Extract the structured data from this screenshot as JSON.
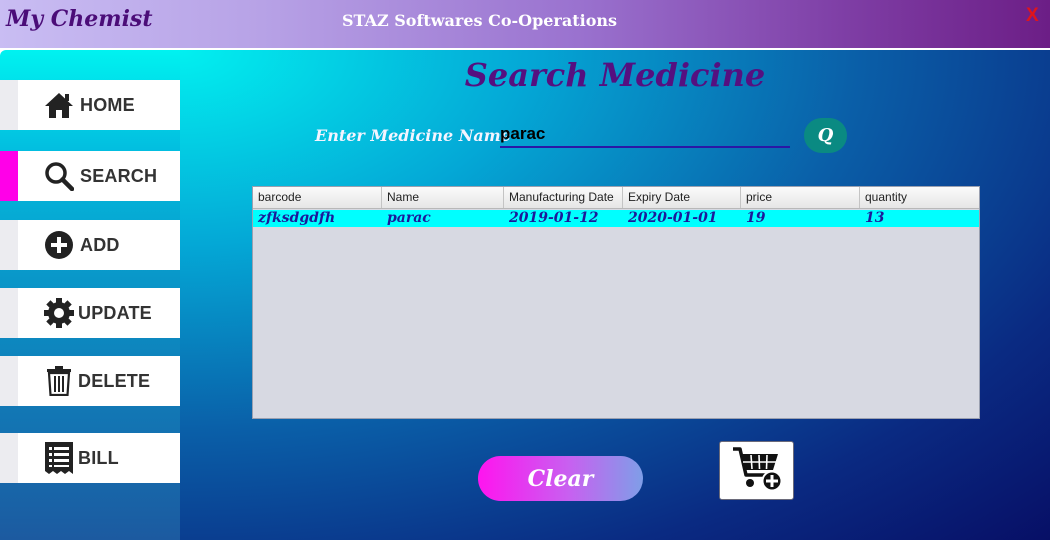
{
  "window": {
    "app_title": "My Chemist",
    "company": "STAZ Softwares Co-Operations",
    "close_label": "X"
  },
  "sidebar": {
    "items": [
      {
        "label": "HOME",
        "icon": "home-icon",
        "active": false
      },
      {
        "label": "SEARCH",
        "icon": "search-icon",
        "active": true
      },
      {
        "label": "ADD",
        "icon": "plus-circle-icon",
        "active": false
      },
      {
        "label": "UPDATE",
        "icon": "gear-icon",
        "active": false
      },
      {
        "label": "DELETE",
        "icon": "trash-icon",
        "active": false
      },
      {
        "label": "BILL",
        "icon": "receipt-icon",
        "active": false
      }
    ]
  },
  "main": {
    "title": "Search Medicine",
    "search_label": "Enter Medicine Name",
    "search_value": "parac",
    "search_button_label": "Q",
    "table": {
      "columns": [
        "barcode",
        "Name",
        "Manufacturing Date",
        "Expiry Date",
        "price",
        "quantity"
      ],
      "rows": [
        [
          "zfksdgdfh",
          "parac",
          "2019-01-12",
          "2020-01-01",
          "19",
          "13"
        ]
      ]
    },
    "clear_label": "Clear",
    "cart_icon": "add-to-cart-icon"
  },
  "colors": {
    "accent_magenta": "#ff00e8",
    "title_purple": "#551080",
    "row_highlight": "#00ffff"
  }
}
